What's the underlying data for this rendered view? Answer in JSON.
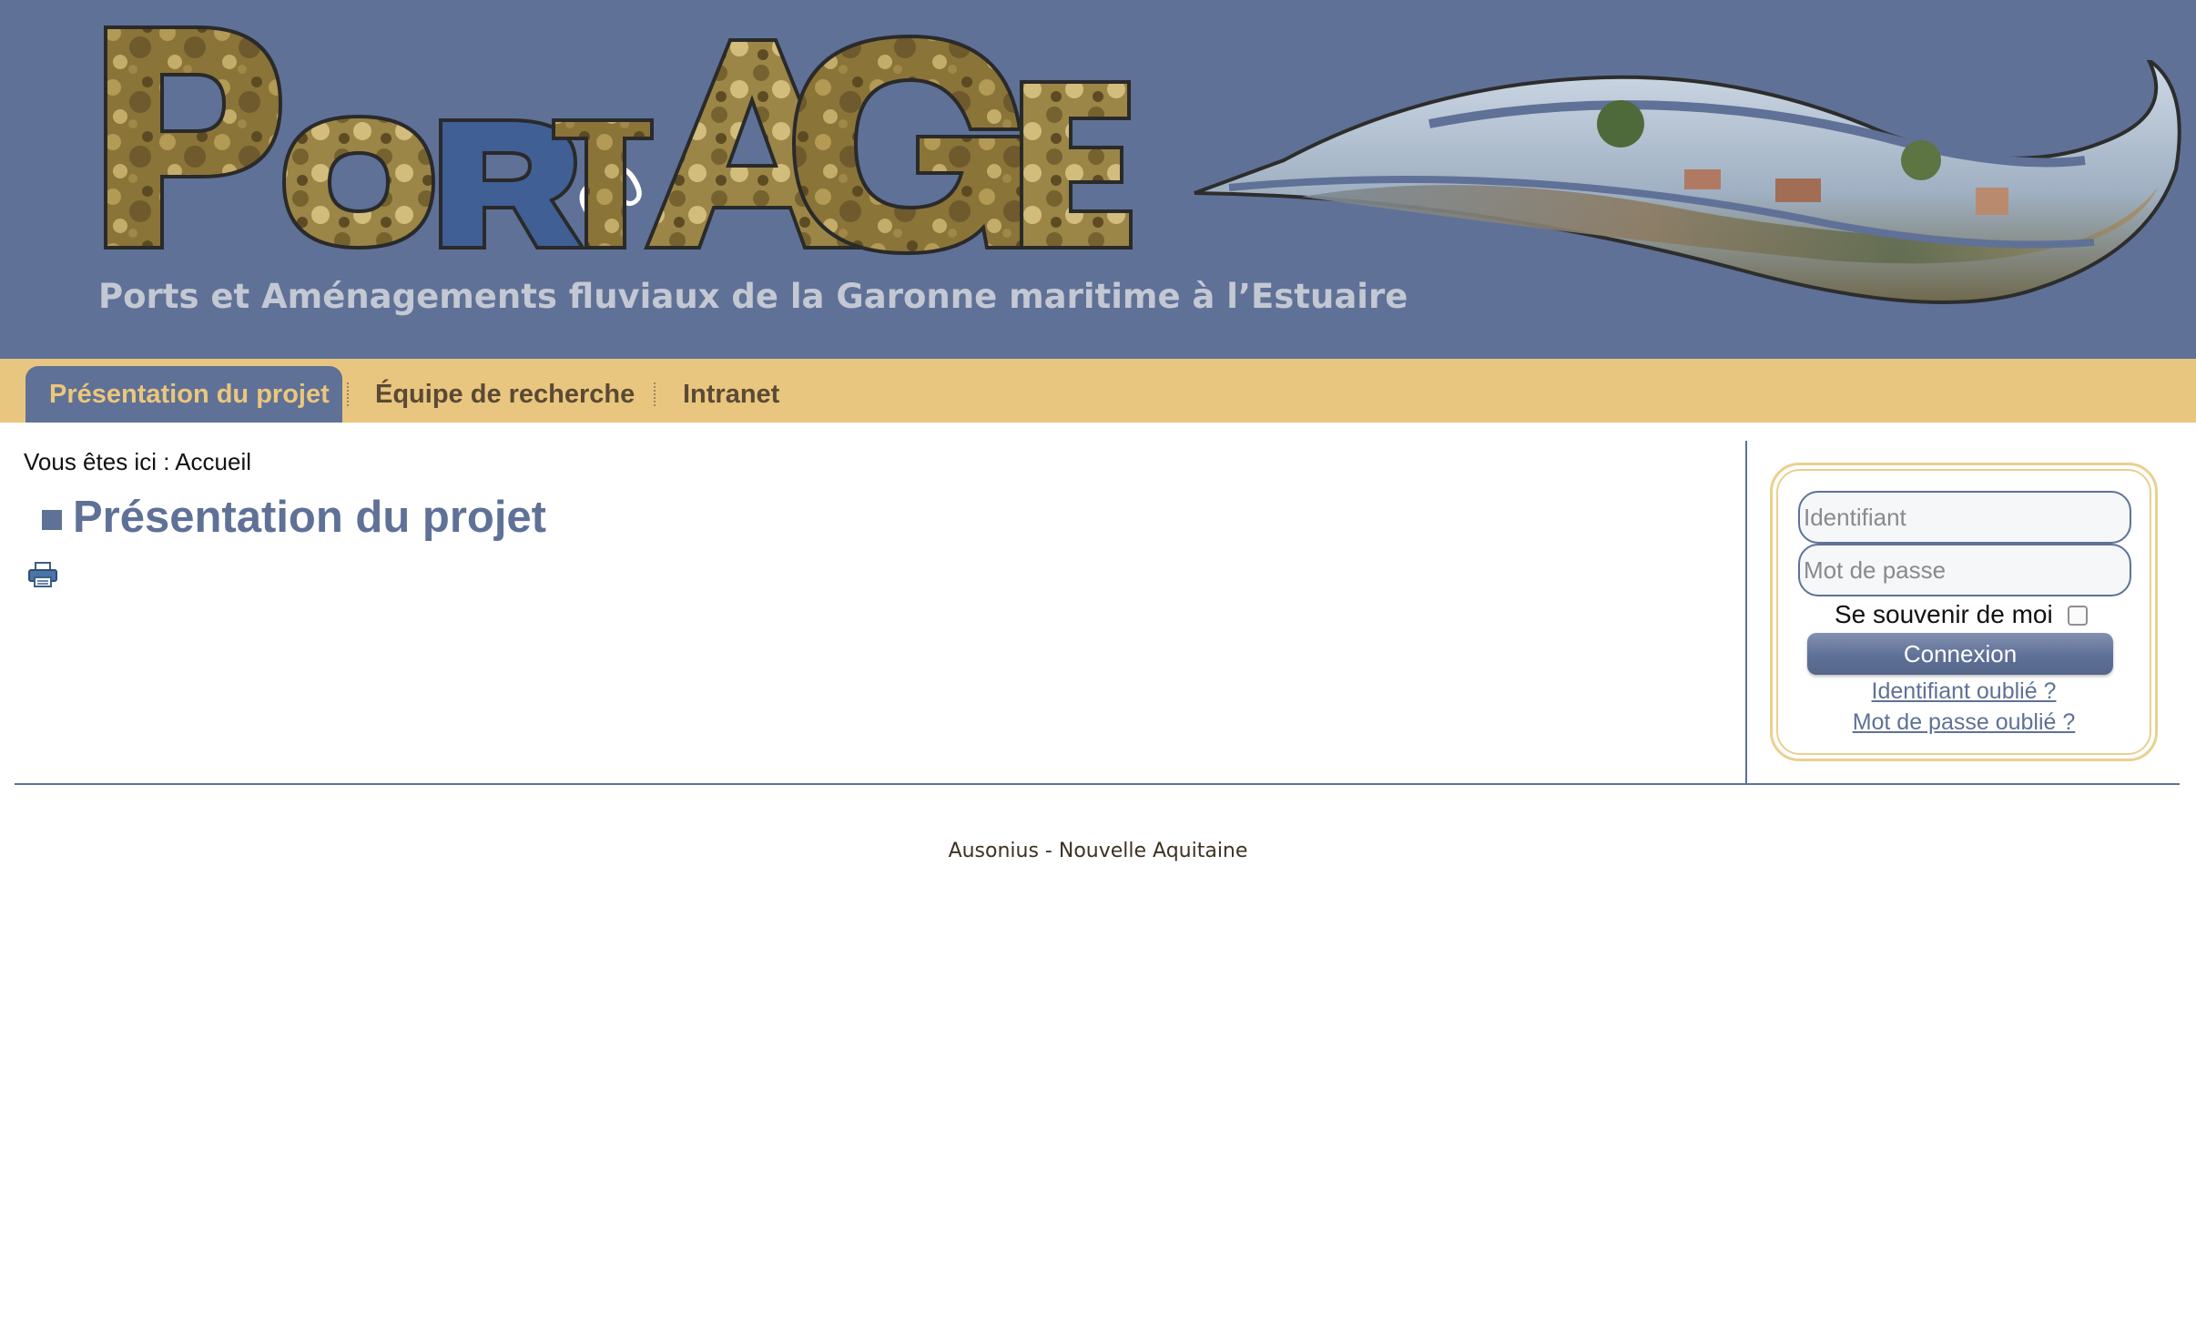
{
  "header": {
    "logo_text": "PortAGE",
    "tagline": "Ports et Aménagements fluviaux de la Garonne maritime à l’Estuaire"
  },
  "nav": {
    "items": [
      {
        "label": "Présentation du projet",
        "active": true
      },
      {
        "label": "Équipe de recherche",
        "active": false
      },
      {
        "label": "Intranet",
        "active": false
      }
    ]
  },
  "breadcrumb": {
    "text": "Vous êtes ici : Accueil"
  },
  "main": {
    "title": "Présentation du projet",
    "print_icon": "printer-icon"
  },
  "login": {
    "username_placeholder": "Identifiant",
    "password_placeholder": "Mot de passe",
    "remember_label": "Se souvenir de moi",
    "remember_checked": false,
    "submit_label": "Connexion",
    "forgot_username": "Identifiant oublié ?",
    "forgot_password": "Mot de passe oublié ?"
  },
  "footer": {
    "text": "Ausonius - Nouvelle Aquitaine"
  },
  "colors": {
    "banner_bg": "#5f7197",
    "nav_bg": "#e9c67f",
    "accent": "#ebc77b",
    "title": "#5f7197"
  }
}
